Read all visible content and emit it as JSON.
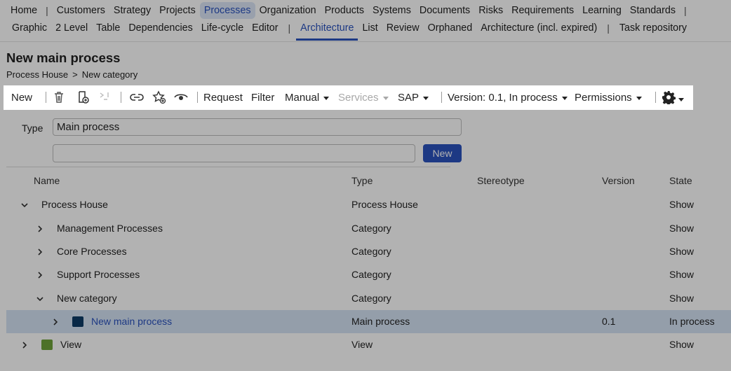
{
  "nav": {
    "primary": [
      {
        "label": "Home",
        "active": false
      },
      {
        "label": "Customers",
        "active": false
      },
      {
        "label": "Strategy",
        "active": false
      },
      {
        "label": "Projects",
        "active": false
      },
      {
        "label": "Processes",
        "active": true
      },
      {
        "label": "Organization",
        "active": false
      },
      {
        "label": "Products",
        "active": false
      },
      {
        "label": "Systems",
        "active": false
      },
      {
        "label": "Documents",
        "active": false
      },
      {
        "label": "Risks",
        "active": false
      },
      {
        "label": "Requirements",
        "active": false
      },
      {
        "label": "Learning",
        "active": false
      },
      {
        "label": "Standards",
        "active": false
      }
    ],
    "secondary": [
      {
        "label": "Graphic",
        "active": false
      },
      {
        "label": "2 Level",
        "active": false
      },
      {
        "label": "Table",
        "active": false
      },
      {
        "label": "Dependencies",
        "active": false
      },
      {
        "label": "Life-cycle",
        "active": false
      },
      {
        "label": "Editor",
        "active": false
      },
      {
        "label": "Architecture",
        "active": true
      },
      {
        "label": "List",
        "active": false
      },
      {
        "label": "Review",
        "active": false
      },
      {
        "label": "Orphaned",
        "active": false
      },
      {
        "label": "Architecture (incl. expired)",
        "active": false
      },
      {
        "label": "Task repository",
        "active": false
      }
    ]
  },
  "page": {
    "title": "New main process",
    "breadcrumb": [
      "Process House",
      "New category"
    ],
    "breadcrumb_sep": ">"
  },
  "toolbar": {
    "new_label": "New",
    "request_label": "Request",
    "filter_label": "Filter",
    "manual_label": "Manual",
    "services_label": "Services",
    "sap_label": "SAP",
    "version_label": "Version: 0.1, In process",
    "permissions_label": "Permissions",
    "icons": [
      "trash-icon",
      "add-document-icon",
      "unlink-icon",
      "link-icon",
      "add-favorite-icon",
      "eye-icon",
      "gear-icon"
    ]
  },
  "form": {
    "type_label": "Type",
    "type_value": "Main process",
    "new_input_value": "",
    "new_button_label": "New"
  },
  "table": {
    "headers": {
      "name": "Name",
      "type": "Type",
      "stereotype": "Stereotype",
      "version": "Version",
      "state": "State"
    },
    "rows": [
      {
        "name": "Process House",
        "type": "Process House",
        "stereotype": "",
        "version": "",
        "state": "Show",
        "expanded": true,
        "level": 0,
        "link": false,
        "selected": false,
        "square": ""
      },
      {
        "name": "Management Processes",
        "type": "Category",
        "stereotype": "",
        "version": "",
        "state": "Show",
        "expanded": false,
        "level": 1,
        "link": false,
        "selected": false,
        "square": ""
      },
      {
        "name": "Core Processes",
        "type": "Category",
        "stereotype": "",
        "version": "",
        "state": "Show",
        "expanded": false,
        "level": 1,
        "link": false,
        "selected": false,
        "square": ""
      },
      {
        "name": "Support Processes",
        "type": "Category",
        "stereotype": "",
        "version": "",
        "state": "Show",
        "expanded": false,
        "level": 1,
        "link": false,
        "selected": false,
        "square": ""
      },
      {
        "name": "New category",
        "type": "Category",
        "stereotype": "",
        "version": "",
        "state": "Show",
        "expanded": true,
        "level": 1,
        "link": false,
        "selected": false,
        "square": ""
      },
      {
        "name": "New main process",
        "type": "Main process",
        "stereotype": "",
        "version": "0.1",
        "state": "In process",
        "expanded": false,
        "level": 2,
        "link": true,
        "selected": true,
        "square": "#0d3b66"
      },
      {
        "name": "View",
        "type": "View",
        "stereotype": "",
        "version": "",
        "state": "Show",
        "expanded": false,
        "level": 0,
        "link": false,
        "selected": false,
        "square": "#6fa23a"
      }
    ]
  },
  "colors": {
    "accent": "#2a52be",
    "selected_row": "#d5e3f4",
    "overlay": "rgba(0,0,0,0.30)"
  }
}
